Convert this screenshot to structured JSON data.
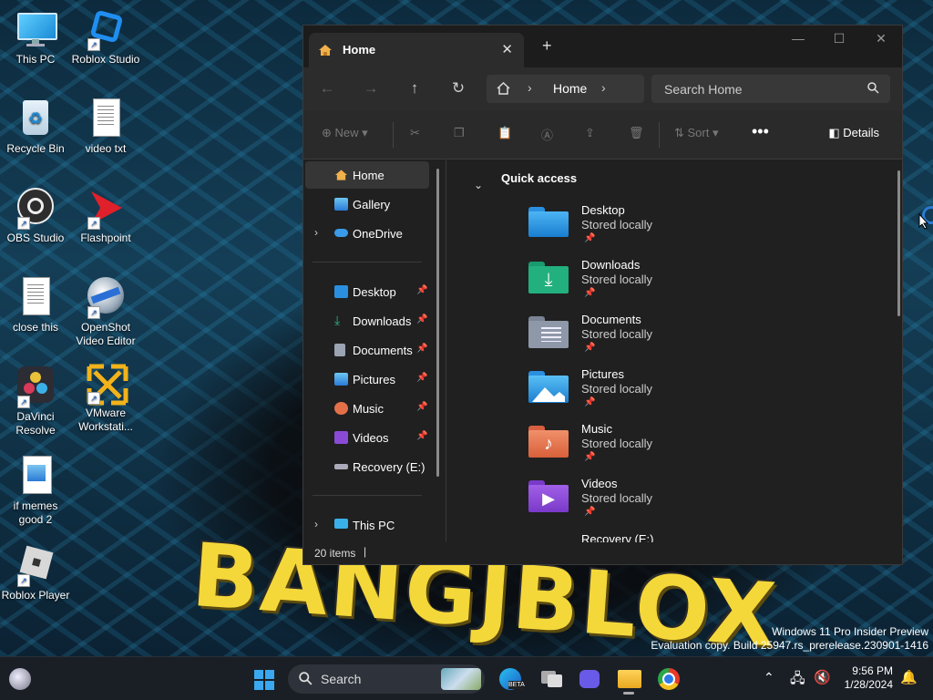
{
  "desktop": {
    "icons": [
      {
        "label": "This PC"
      },
      {
        "label": "Roblox Studio"
      },
      {
        "label": "Recycle Bin"
      },
      {
        "label": "video txt"
      },
      {
        "label": "OBS Studio"
      },
      {
        "label": "Flashpoint"
      },
      {
        "label": "close this"
      },
      {
        "label": "OpenShot Video Editor"
      },
      {
        "label": "DaVinci Resolve"
      },
      {
        "label": "VMware Workstati..."
      },
      {
        "label": "if memes good 2"
      },
      {
        "label": "Roblox Player"
      }
    ],
    "wallpaper_text": "BANGJBLOX",
    "watermark_line1": "Windows 11 Pro Insider Preview",
    "watermark_line2": "Evaluation copy. Build 25947.rs_prerelease.230901-1416"
  },
  "explorer": {
    "tab_title": "Home",
    "address": {
      "location": "Home"
    },
    "search_placeholder": "Search Home",
    "toolbar": {
      "new_label": "New",
      "sort_label": "Sort",
      "details_label": "Details"
    },
    "sidebar": {
      "top": [
        {
          "label": "Home"
        },
        {
          "label": "Gallery"
        },
        {
          "label": "OneDrive"
        }
      ],
      "pinned": [
        {
          "label": "Desktop"
        },
        {
          "label": "Downloads"
        },
        {
          "label": "Documents"
        },
        {
          "label": "Pictures"
        },
        {
          "label": "Music"
        },
        {
          "label": "Videos"
        },
        {
          "label": "Recovery (E:)"
        }
      ],
      "this_pc": "This PC"
    },
    "quick_access": {
      "heading": "Quick access",
      "folders": [
        {
          "name": "Desktop",
          "status": "Stored locally"
        },
        {
          "name": "Downloads",
          "status": "Stored locally"
        },
        {
          "name": "Documents",
          "status": "Stored locally"
        },
        {
          "name": "Pictures",
          "status": "Stored locally"
        },
        {
          "name": "Music",
          "status": "Stored locally"
        },
        {
          "name": "Videos",
          "status": "Stored locally"
        },
        {
          "name": "Recovery (E:)"
        }
      ]
    },
    "status": {
      "item_count": "20 items"
    }
  },
  "taskbar": {
    "search_label": "Search",
    "time": "9:56 PM",
    "date": "1/28/2024"
  },
  "colors": {
    "accent": "#0078d4",
    "window_bg": "#202020",
    "folder_blue": "#2b8fe0",
    "folder_green": "#1fa67a",
    "wallpaper_text": "#f4d83a"
  }
}
